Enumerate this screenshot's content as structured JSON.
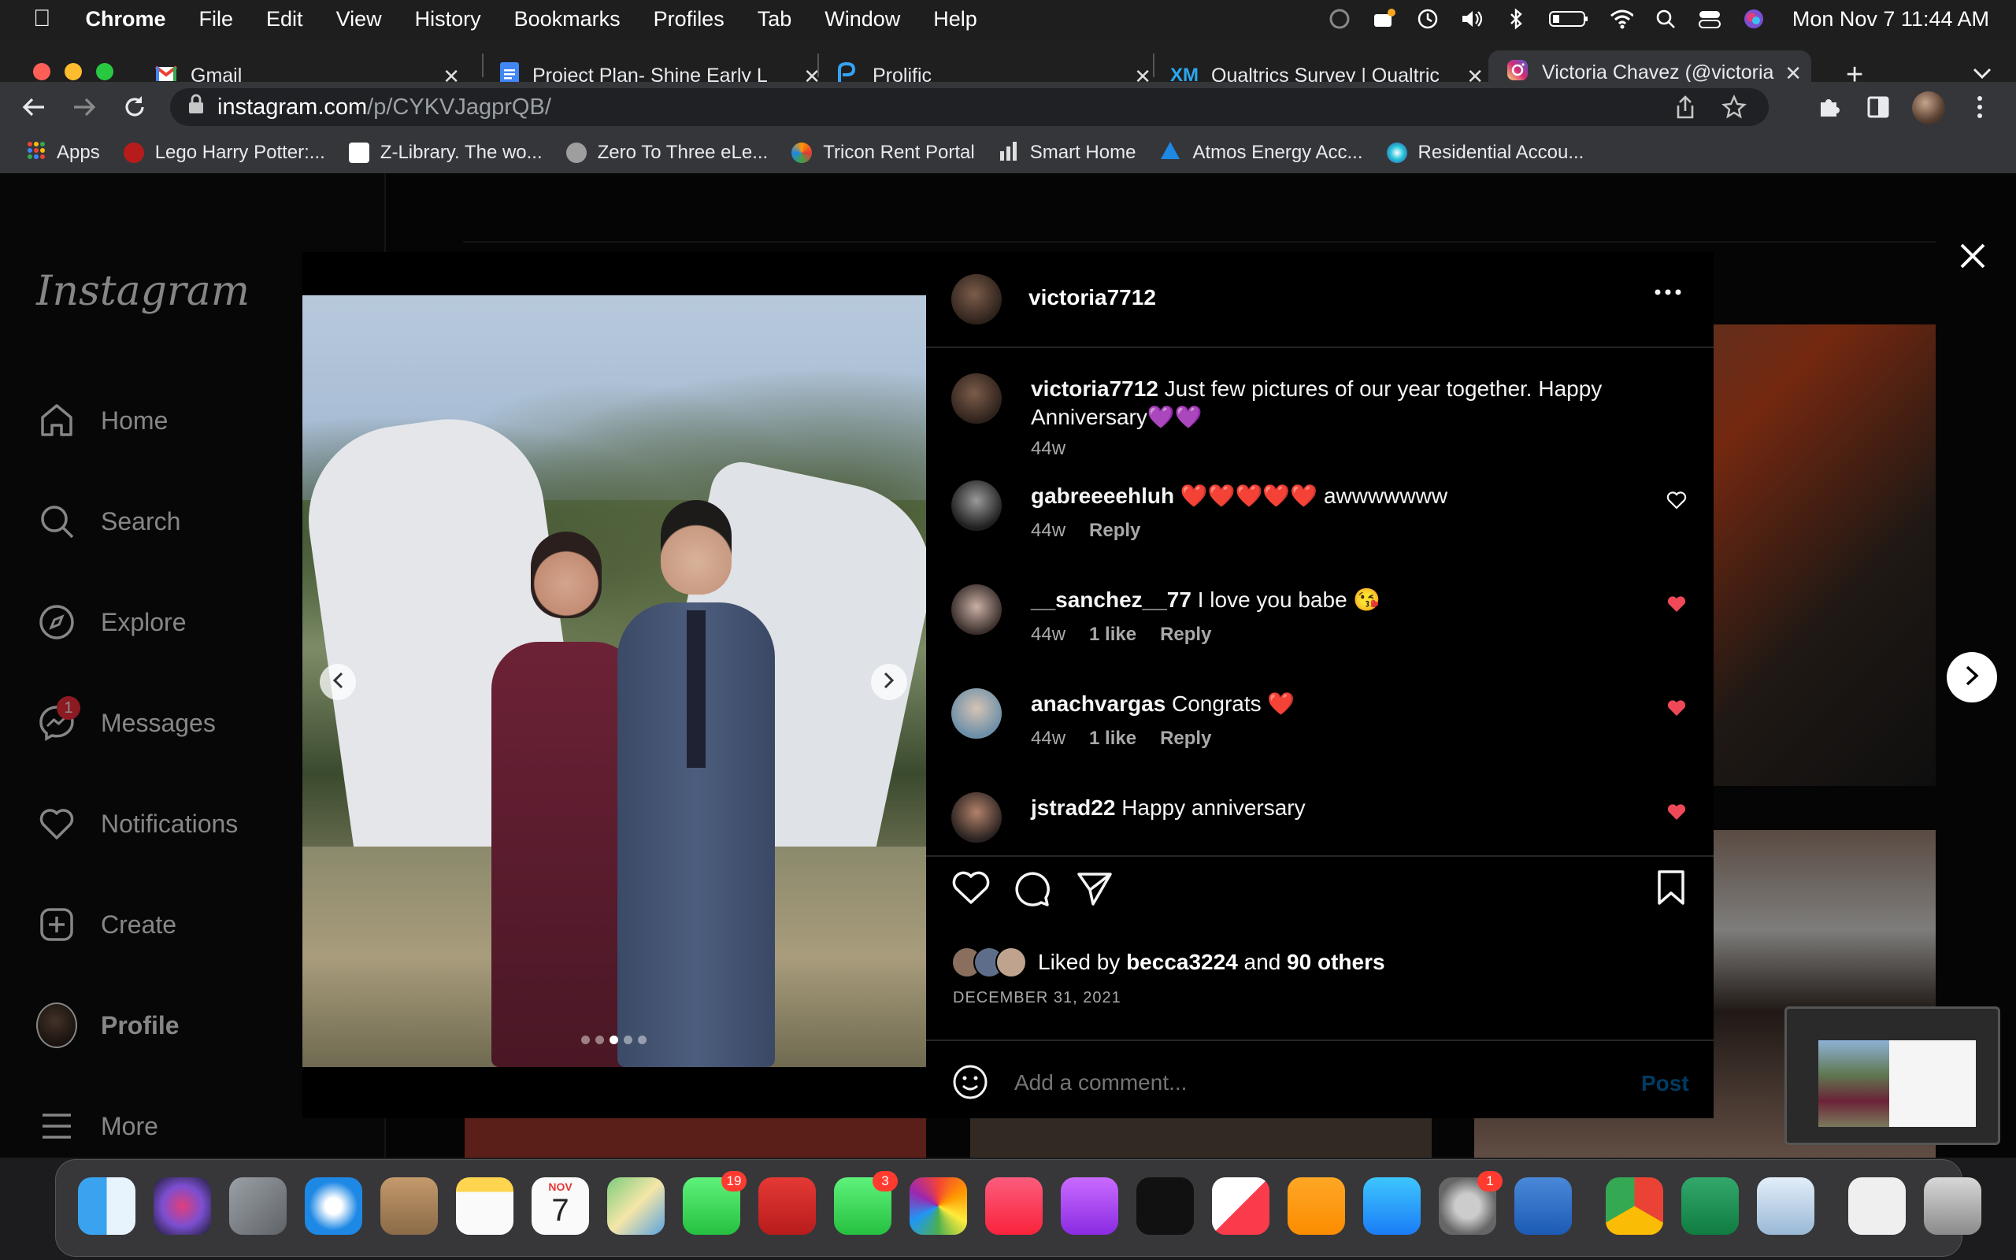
{
  "menubar": {
    "app": "Chrome",
    "items": [
      "File",
      "Edit",
      "View",
      "History",
      "Bookmarks",
      "Profiles",
      "Tab",
      "Window",
      "Help"
    ],
    "clock": "Mon Nov 7  11:44 AM"
  },
  "tabs": [
    {
      "title": "Gmail"
    },
    {
      "title": "Project Plan- Shine Early L"
    },
    {
      "title": "Prolific"
    },
    {
      "title": "Qualtrics Survey | Qualtric"
    },
    {
      "title": "Victoria Chavez (@victoria"
    }
  ],
  "address": {
    "host": "instagram.com",
    "path": "/p/CYKVJagprQB/"
  },
  "bookmarks": [
    {
      "label": "Apps",
      "color": "#ea4335"
    },
    {
      "label": "Lego Harry Potter:...",
      "color": "#b71c1c"
    },
    {
      "label": "Z-Library. The wo...",
      "color": "#ffffff"
    },
    {
      "label": "Zero To Three eLe...",
      "color": "#9e9e9e"
    },
    {
      "label": "Tricon Rent Portal",
      "color": "#ff9800"
    },
    {
      "label": "Smart Home",
      "color": "#e0e0e0"
    },
    {
      "label": "Atmos Energy Acc...",
      "color": "#1e88e5"
    },
    {
      "label": "Residential Accou...",
      "color": "#26c6da"
    }
  ],
  "sidebar": {
    "logo": "Instagram",
    "items": [
      {
        "label": "Home",
        "icon": "home-icon"
      },
      {
        "label": "Search",
        "icon": "search-icon"
      },
      {
        "label": "Explore",
        "icon": "compass-icon"
      },
      {
        "label": "Messages",
        "icon": "messenger-icon",
        "badge": "1"
      },
      {
        "label": "Notifications",
        "icon": "heart-icon"
      },
      {
        "label": "Create",
        "icon": "plus-square-icon"
      },
      {
        "label": "Profile",
        "icon": "avatar-icon"
      },
      {
        "label": "More",
        "icon": "menu-icon"
      }
    ]
  },
  "post": {
    "username": "victoria7712",
    "caption_user": "victoria7712",
    "caption": "Just few pictures of our year together. Happy Anniversary💜💜",
    "caption_time": "44w",
    "comments": [
      {
        "user": "gabreeeehluh",
        "text": "❤️❤️❤️❤️❤️ awwwwwww",
        "time": "44w",
        "likes": "",
        "reply": "Reply",
        "liked": false
      },
      {
        "user": "__sanchez__77",
        "text": "I love you babe 😘",
        "time": "44w",
        "likes": "1 like",
        "reply": "Reply",
        "liked": true
      },
      {
        "user": "anachvargas",
        "text": "Congrats ❤️",
        "time": "44w",
        "likes": "1 like",
        "reply": "Reply",
        "liked": true
      },
      {
        "user": "jstrad22",
        "text": "Happy anniversary",
        "time": "",
        "likes": "",
        "reply": "",
        "liked": true
      }
    ],
    "liked_by_prefix": "Liked by",
    "liked_by_user": "becca3224",
    "liked_by_and": "and",
    "liked_by_others": "90 others",
    "date": "DECEMBER 31, 2021",
    "comment_placeholder": "Add a comment...",
    "post_button": "Post",
    "carousel_index": 3,
    "carousel_count": 5
  },
  "dock_badges": {
    "messages": "19",
    "photobooth": "",
    "facetime": "3",
    "settings": "1"
  },
  "dock_calendar": {
    "month": "NOV",
    "day": "7"
  },
  "colors": {
    "like_red": "#ed4956",
    "link_blue": "#0095f6"
  }
}
